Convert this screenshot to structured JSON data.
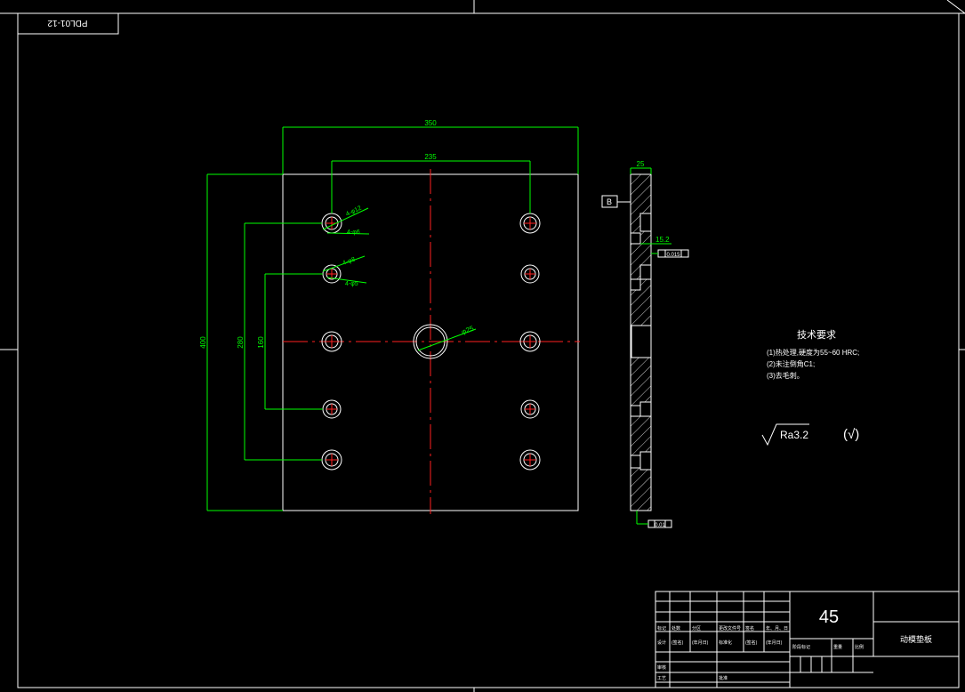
{
  "drawing_code": "PDL01-12",
  "dims": {
    "width_outer": "350",
    "width_inner": "235",
    "height_outer": "400",
    "height_280": "280",
    "height_160": "160",
    "side_thickness": "25",
    "side_depth": "15.2",
    "center_hole": "φ25",
    "hole_callout_1": "4-φ12",
    "hole_callout_2": "4-φ6",
    "hole_callout_3": "4-φ8",
    "hole_callout_4": "4-φ5"
  },
  "datum_label": "B",
  "tolerance_frames": [
    "0.015",
    "0.01"
  ],
  "tech_requirements": {
    "title": "技术要求",
    "items": [
      "(1)热处理,硬度为55~60 HRC;",
      "(2)未注倒角C1;",
      "(3)去毛刺。"
    ]
  },
  "roughness": {
    "value": "Ra3.2",
    "other": "(√)"
  },
  "title_block": {
    "material": "45",
    "part_name": "动模垫板",
    "labels": [
      "标记",
      "处数",
      "分区",
      "更改文件号",
      "签名",
      "年、月、日",
      "设计",
      "(签名)",
      "(年月日)",
      "标准化",
      "(签名)",
      "(年月日)",
      "阶段标记",
      "重量",
      "比例",
      "审核",
      "工艺",
      "批准"
    ]
  },
  "colors": {
    "background": "#000000",
    "outline": "#ffffff",
    "dimension": "#00ff00",
    "centerline": "#ff2020"
  }
}
